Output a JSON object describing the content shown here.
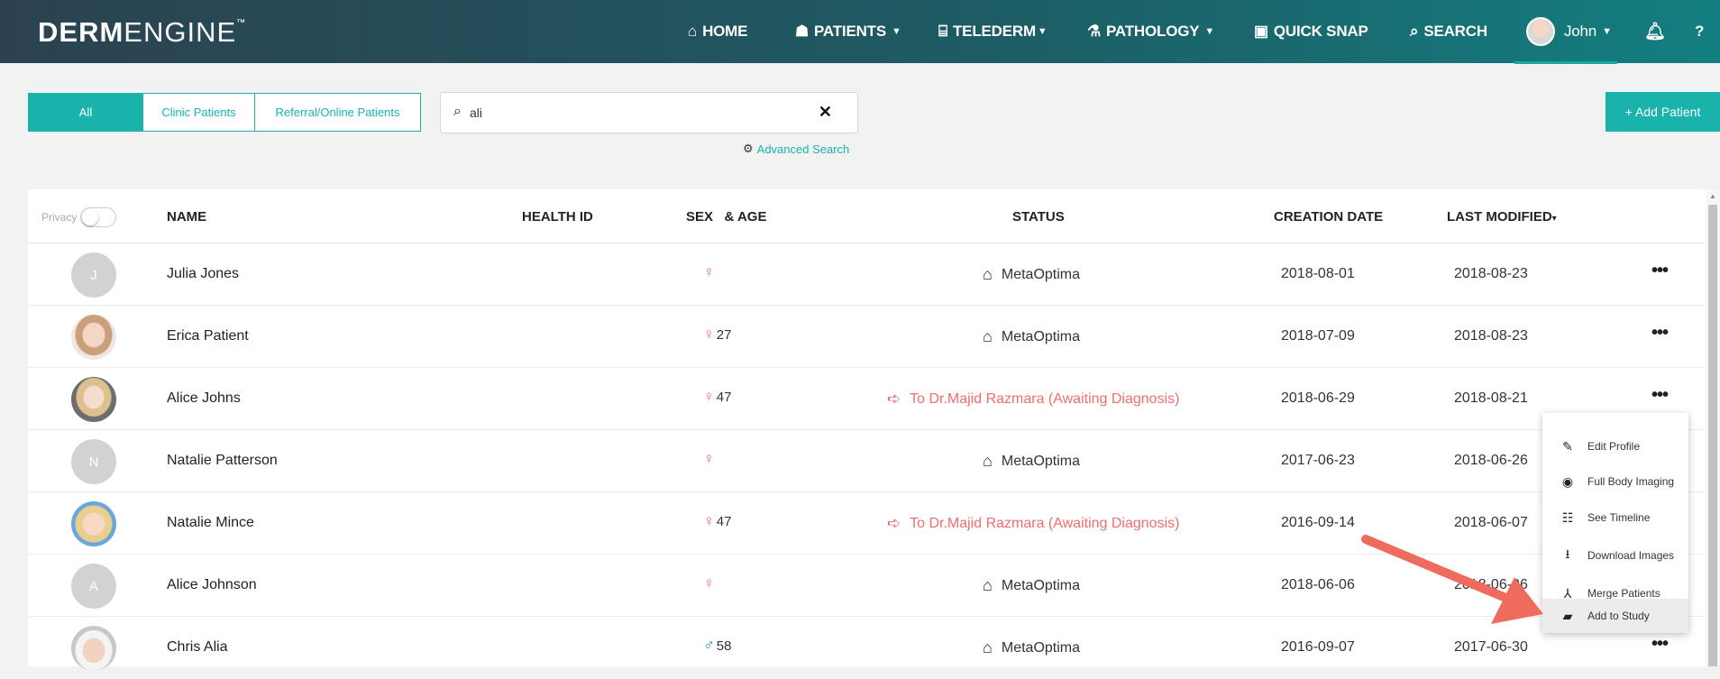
{
  "app": {
    "logo_bold": "DERM",
    "logo_thin": "ENGINE",
    "logo_tm": "™"
  },
  "nav": {
    "home": "HOME",
    "patients": "PATIENTS",
    "telederm": "TELEDERM",
    "pathology": "PATHOLOGY",
    "quick_snap": "QUICK SNAP",
    "search": "SEARCH",
    "user": "John"
  },
  "filters": {
    "all": "All",
    "clinic": "Clinic Patients",
    "referral": "Referral/Online Patients"
  },
  "search": {
    "value": "ali",
    "advanced": "Advanced Search"
  },
  "add_patient": "+ Add Patient",
  "table": {
    "privacy": "Privacy",
    "headers": {
      "name": "NAME",
      "health_id": "HEALTH ID",
      "sex_age": "SEX   & AGE",
      "status": "STATUS",
      "creation_date": "CREATION DATE",
      "last_modified": "LAST MODIFIED",
      "sort_marker": "▾"
    },
    "rows": [
      {
        "initial": "J",
        "name": "Julia Jones",
        "sex": "female",
        "age": "",
        "status": "MetaOptima",
        "status_type": "clinic",
        "created": "2018-08-01",
        "modified": "2018-08-23"
      },
      {
        "initial": "",
        "name": "Erica Patient",
        "sex": "female",
        "age": "27",
        "status": "MetaOptima",
        "status_type": "clinic",
        "created": "2018-07-09",
        "modified": "2018-08-23"
      },
      {
        "initial": "",
        "name": "Alice Johns",
        "sex": "female",
        "age": "47",
        "status": "To Dr.Majid Razmara (Awaiting Diagnosis)",
        "status_type": "referral",
        "created": "2018-06-29",
        "modified": "2018-08-21"
      },
      {
        "initial": "N",
        "name": "Natalie Patterson",
        "sex": "female",
        "age": "",
        "status": "MetaOptima",
        "status_type": "clinic",
        "created": "2017-06-23",
        "modified": "2018-06-26"
      },
      {
        "initial": "",
        "name": "Natalie Mince",
        "sex": "female",
        "age": "47",
        "status": "To Dr.Majid Razmara (Awaiting Diagnosis)",
        "status_type": "referral",
        "created": "2016-09-14",
        "modified": "2018-06-07"
      },
      {
        "initial": "A",
        "name": "Alice Johnson",
        "sex": "female",
        "age": "",
        "status": "MetaOptima",
        "status_type": "clinic",
        "created": "2018-06-06",
        "modified": "2018-06-06"
      },
      {
        "initial": "",
        "name": "Chris Alia",
        "sex": "male",
        "age": "58",
        "status": "MetaOptima",
        "status_type": "clinic",
        "created": "2016-09-07",
        "modified": "2017-06-30"
      }
    ]
  },
  "context_menu": {
    "items": [
      {
        "label": "Edit Profile",
        "icon": "pencil-icon"
      },
      {
        "label": "Full Body Imaging",
        "icon": "body-scan-icon"
      },
      {
        "label": "See Timeline",
        "icon": "timeline-icon"
      },
      {
        "label": "Download Images",
        "icon": "download-icon"
      },
      {
        "label": "Merge Patients",
        "icon": "merge-icon"
      },
      {
        "label": "Add to Study",
        "icon": "study-folder-icon"
      }
    ]
  },
  "colors": {
    "accent": "#19b3ac",
    "female": "#f26d6d",
    "male": "#1f8ed8",
    "annotation_arrow": "#ee6b5e"
  }
}
